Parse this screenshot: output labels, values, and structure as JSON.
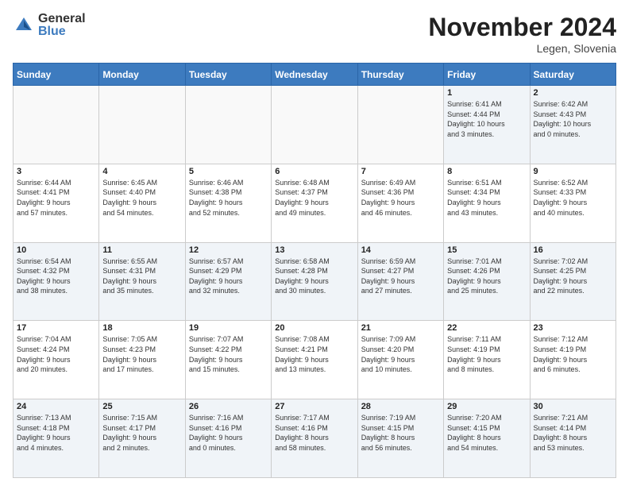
{
  "header": {
    "logo_general": "General",
    "logo_blue": "Blue",
    "month_title": "November 2024",
    "location": "Legen, Slovenia"
  },
  "days_of_week": [
    "Sunday",
    "Monday",
    "Tuesday",
    "Wednesday",
    "Thursday",
    "Friday",
    "Saturday"
  ],
  "weeks": [
    {
      "row": 1,
      "days": [
        {
          "num": "",
          "info": ""
        },
        {
          "num": "",
          "info": ""
        },
        {
          "num": "",
          "info": ""
        },
        {
          "num": "",
          "info": ""
        },
        {
          "num": "",
          "info": ""
        },
        {
          "num": "1",
          "info": "Sunrise: 6:41 AM\nSunset: 4:44 PM\nDaylight: 10 hours\nand 3 minutes."
        },
        {
          "num": "2",
          "info": "Sunrise: 6:42 AM\nSunset: 4:43 PM\nDaylight: 10 hours\nand 0 minutes."
        }
      ]
    },
    {
      "row": 2,
      "days": [
        {
          "num": "3",
          "info": "Sunrise: 6:44 AM\nSunset: 4:41 PM\nDaylight: 9 hours\nand 57 minutes."
        },
        {
          "num": "4",
          "info": "Sunrise: 6:45 AM\nSunset: 4:40 PM\nDaylight: 9 hours\nand 54 minutes."
        },
        {
          "num": "5",
          "info": "Sunrise: 6:46 AM\nSunset: 4:38 PM\nDaylight: 9 hours\nand 52 minutes."
        },
        {
          "num": "6",
          "info": "Sunrise: 6:48 AM\nSunset: 4:37 PM\nDaylight: 9 hours\nand 49 minutes."
        },
        {
          "num": "7",
          "info": "Sunrise: 6:49 AM\nSunset: 4:36 PM\nDaylight: 9 hours\nand 46 minutes."
        },
        {
          "num": "8",
          "info": "Sunrise: 6:51 AM\nSunset: 4:34 PM\nDaylight: 9 hours\nand 43 minutes."
        },
        {
          "num": "9",
          "info": "Sunrise: 6:52 AM\nSunset: 4:33 PM\nDaylight: 9 hours\nand 40 minutes."
        }
      ]
    },
    {
      "row": 3,
      "days": [
        {
          "num": "10",
          "info": "Sunrise: 6:54 AM\nSunset: 4:32 PM\nDaylight: 9 hours\nand 38 minutes."
        },
        {
          "num": "11",
          "info": "Sunrise: 6:55 AM\nSunset: 4:31 PM\nDaylight: 9 hours\nand 35 minutes."
        },
        {
          "num": "12",
          "info": "Sunrise: 6:57 AM\nSunset: 4:29 PM\nDaylight: 9 hours\nand 32 minutes."
        },
        {
          "num": "13",
          "info": "Sunrise: 6:58 AM\nSunset: 4:28 PM\nDaylight: 9 hours\nand 30 minutes."
        },
        {
          "num": "14",
          "info": "Sunrise: 6:59 AM\nSunset: 4:27 PM\nDaylight: 9 hours\nand 27 minutes."
        },
        {
          "num": "15",
          "info": "Sunrise: 7:01 AM\nSunset: 4:26 PM\nDaylight: 9 hours\nand 25 minutes."
        },
        {
          "num": "16",
          "info": "Sunrise: 7:02 AM\nSunset: 4:25 PM\nDaylight: 9 hours\nand 22 minutes."
        }
      ]
    },
    {
      "row": 4,
      "days": [
        {
          "num": "17",
          "info": "Sunrise: 7:04 AM\nSunset: 4:24 PM\nDaylight: 9 hours\nand 20 minutes."
        },
        {
          "num": "18",
          "info": "Sunrise: 7:05 AM\nSunset: 4:23 PM\nDaylight: 9 hours\nand 17 minutes."
        },
        {
          "num": "19",
          "info": "Sunrise: 7:07 AM\nSunset: 4:22 PM\nDaylight: 9 hours\nand 15 minutes."
        },
        {
          "num": "20",
          "info": "Sunrise: 7:08 AM\nSunset: 4:21 PM\nDaylight: 9 hours\nand 13 minutes."
        },
        {
          "num": "21",
          "info": "Sunrise: 7:09 AM\nSunset: 4:20 PM\nDaylight: 9 hours\nand 10 minutes."
        },
        {
          "num": "22",
          "info": "Sunrise: 7:11 AM\nSunset: 4:19 PM\nDaylight: 9 hours\nand 8 minutes."
        },
        {
          "num": "23",
          "info": "Sunrise: 7:12 AM\nSunset: 4:19 PM\nDaylight: 9 hours\nand 6 minutes."
        }
      ]
    },
    {
      "row": 5,
      "days": [
        {
          "num": "24",
          "info": "Sunrise: 7:13 AM\nSunset: 4:18 PM\nDaylight: 9 hours\nand 4 minutes."
        },
        {
          "num": "25",
          "info": "Sunrise: 7:15 AM\nSunset: 4:17 PM\nDaylight: 9 hours\nand 2 minutes."
        },
        {
          "num": "26",
          "info": "Sunrise: 7:16 AM\nSunset: 4:16 PM\nDaylight: 9 hours\nand 0 minutes."
        },
        {
          "num": "27",
          "info": "Sunrise: 7:17 AM\nSunset: 4:16 PM\nDaylight: 8 hours\nand 58 minutes."
        },
        {
          "num": "28",
          "info": "Sunrise: 7:19 AM\nSunset: 4:15 PM\nDaylight: 8 hours\nand 56 minutes."
        },
        {
          "num": "29",
          "info": "Sunrise: 7:20 AM\nSunset: 4:15 PM\nDaylight: 8 hours\nand 54 minutes."
        },
        {
          "num": "30",
          "info": "Sunrise: 7:21 AM\nSunset: 4:14 PM\nDaylight: 8 hours\nand 53 minutes."
        }
      ]
    }
  ]
}
